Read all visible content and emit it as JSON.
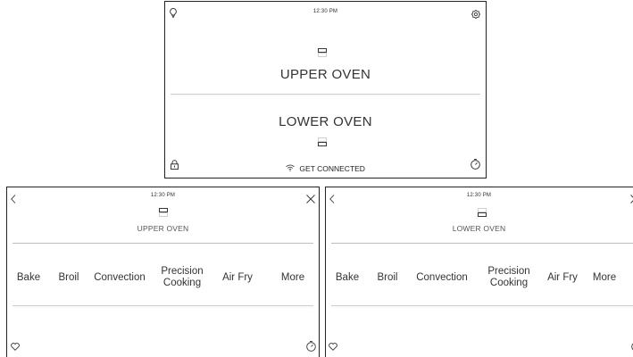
{
  "home": {
    "time": "12:30 PM",
    "upper_label": "UPPER OVEN",
    "lower_label": "LOWER OVEN",
    "connect_label": "GET CONNECTED"
  },
  "upper_panel": {
    "time": "12:30 PM",
    "oven_label": "UPPER OVEN",
    "modes": [
      "Bake",
      "Broil",
      "Convection",
      "Precision\nCooking",
      "Air Fry",
      "More"
    ]
  },
  "lower_panel": {
    "time": "12:30 PM",
    "oven_label": "LOWER OVEN",
    "modes": [
      "Bake",
      "Broil",
      "Convection",
      "Precision\nCooking",
      "Air Fry",
      "More"
    ]
  },
  "icons": {
    "home_top_left": "lightbulb-icon",
    "home_top_right": "settings-gear-icon",
    "home_bottom_left": "lock-icon",
    "home_bottom_right": "timer-icon",
    "connect": "wifi-icon",
    "panel_back": "back-chevron-icon",
    "panel_close": "close-icon",
    "panel_favorite": "heart-icon",
    "panel_timer": "timer-icon"
  }
}
